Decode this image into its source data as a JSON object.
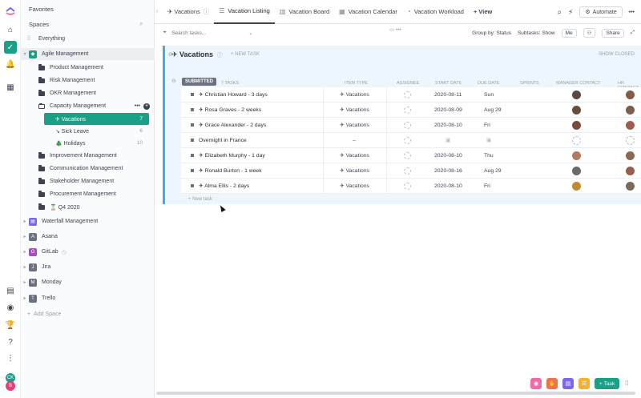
{
  "sidebar": {
    "favorites": "Favorites",
    "spaces": "Spaces",
    "everything": "Everything",
    "add_space": "Add Space",
    "agile": "Agile Management",
    "folders": [
      {
        "label": "Product Management"
      },
      {
        "label": "Risk Management"
      },
      {
        "label": "OKR Management"
      },
      {
        "label": "Capacity Management"
      }
    ],
    "lists": [
      {
        "label": "✈ Vacations",
        "count": "7"
      },
      {
        "label": "↘ Sick Leave",
        "count": "6"
      },
      {
        "label": "🎄 Holidays",
        "count": "10"
      }
    ],
    "more_folders": [
      {
        "label": "Improvement Management"
      },
      {
        "label": "Communication Management"
      },
      {
        "label": "Stakeholder Management"
      },
      {
        "label": "Procurement Management"
      },
      {
        "label": "⏳ Q4 2020"
      }
    ],
    "spaces_list": [
      {
        "label": "Waterfall Management",
        "letter": "",
        "color": "#7b68ee"
      },
      {
        "label": "Asana",
        "letter": "A",
        "color": "#6b7180"
      },
      {
        "label": "GitLab",
        "letter": "G",
        "color": "#a64dbd"
      },
      {
        "label": "Jira",
        "letter": "J",
        "color": "#6b7180"
      },
      {
        "label": "Monday",
        "letter": "M",
        "color": "#6b7180"
      },
      {
        "label": "Trello",
        "letter": "T",
        "color": "#6b7180"
      }
    ]
  },
  "topbar": {
    "breadcrumb": "✈ Vacations",
    "tabs": [
      {
        "label": "Vacation Listing",
        "active": true
      },
      {
        "label": "Vacation Board"
      },
      {
        "label": "Vacation Calendar"
      },
      {
        "label": "Vacation Workload"
      }
    ],
    "add_view": "+ View",
    "automate": "Automate"
  },
  "toolbar": {
    "search_placeholder": "Search tasks...",
    "group_by": "Group by: Status",
    "subtasks": "Subtasks: Show",
    "me": "Me",
    "share": "Share"
  },
  "list": {
    "title": "✈ Vacations",
    "new_task": "+ NEW TASK",
    "show_closed": "SHOW CLOSED",
    "status": "SUBMITTED",
    "task_count": "7 TASKS",
    "columns": {
      "item_type": "ITEM TYPE",
      "assignee": "ASSIGNEE",
      "start_date": "START DATE",
      "due_date": "DUE DATE",
      "sprints": "SPRINTS",
      "manager": "MANAGER CONTACT",
      "hr": "HR CONTACT"
    },
    "tasks": [
      {
        "name": "✈ Christian Howard - 3 days",
        "type": "✈ Vacations",
        "start": "2020-08-11",
        "due": "Sun"
      },
      {
        "name": "✈ Rosa Graves - 2 weeks",
        "type": "✈ Vacations",
        "start": "2020-08-09",
        "due": "Aug 29"
      },
      {
        "name": "✈ Grace Alexander - 2 days",
        "type": "✈ Vacations",
        "start": "2020-08-10",
        "due": "Fri"
      },
      {
        "name": "Overnight in France",
        "type": "–",
        "start": "",
        "due": ""
      },
      {
        "name": "✈ Elizabeth Murphy - 1 day",
        "type": "✈ Vacations",
        "start": "2020-08-10",
        "due": "Thu"
      },
      {
        "name": "✈ Ronald Burton - 1 week",
        "type": "✈ Vacations",
        "start": "2020-08-16",
        "due": "Aug 29"
      },
      {
        "name": "✈ Alma Ellis - 2 days",
        "type": "✈ Vacations",
        "start": "2020-08-10",
        "due": "Fri"
      }
    ],
    "new_task_bottom": "+ New task"
  },
  "actions": {
    "task": "Task"
  }
}
